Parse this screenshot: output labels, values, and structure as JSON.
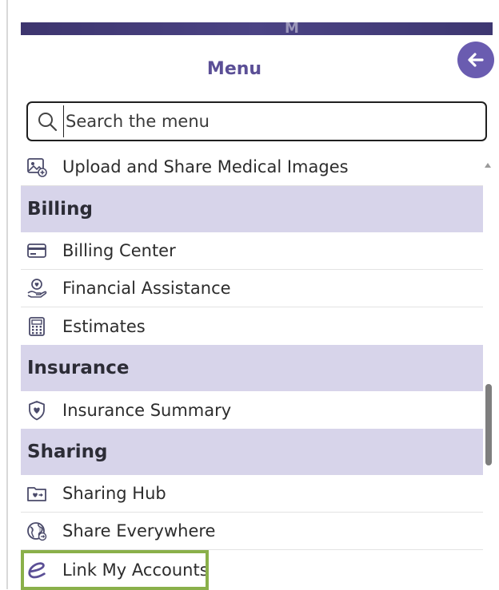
{
  "menu": {
    "title": "Menu",
    "search": {
      "placeholder": "Search the menu",
      "value": ""
    },
    "items_top": [
      {
        "label": "Upload and Share Medical Images",
        "icon": "image-upload-icon"
      }
    ],
    "sections": [
      {
        "title": "Billing",
        "items": [
          {
            "label": "Billing Center",
            "icon": "credit-card-icon"
          },
          {
            "label": "Financial Assistance",
            "icon": "hand-heart-icon"
          },
          {
            "label": "Estimates",
            "icon": "calculator-icon"
          }
        ]
      },
      {
        "title": "Insurance",
        "items": [
          {
            "label": "Insurance Summary",
            "icon": "shield-heart-icon"
          }
        ]
      },
      {
        "title": "Sharing",
        "items": [
          {
            "label": "Sharing Hub",
            "icon": "folder-heart-icon"
          },
          {
            "label": "Share Everywhere",
            "icon": "globe-share-icon"
          },
          {
            "label": "Link My Accounts",
            "icon": "link-e-icon",
            "highlighted": true
          }
        ]
      }
    ]
  },
  "colors": {
    "accent": "#6a5cb0",
    "section_bg": "#d7d4ea",
    "highlight": "#8ab04a",
    "title": "#5b4f96"
  }
}
